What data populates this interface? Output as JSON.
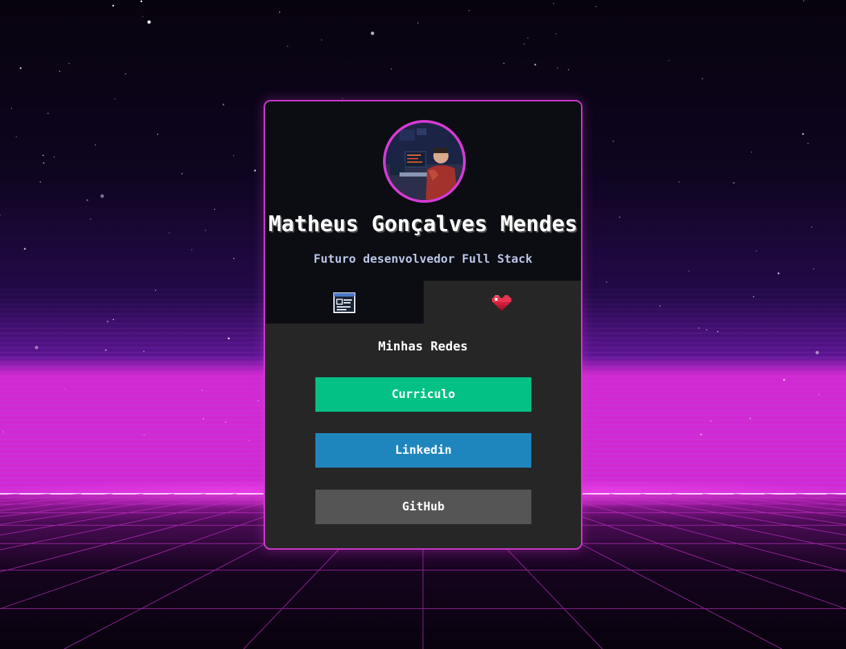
{
  "colors": {
    "accent": "#d53ad3",
    "card_top": "#0b0d12",
    "card_body": "#262626",
    "curriculo": "#03c185",
    "linkedin": "#1f86bd",
    "github": "#555555"
  },
  "profile": {
    "avatar_icon": "profile-photo",
    "name": "Matheus Gonçalves Mendes",
    "subtitle": "Futuro desenvolvedor Full Stack"
  },
  "tabs": [
    {
      "icon": "document-icon",
      "active": false
    },
    {
      "icon": "heart-icon",
      "active": true
    }
  ],
  "links": {
    "title": "Minhas Redes",
    "items": [
      {
        "label": "Curriculo"
      },
      {
        "label": "Linkedin"
      },
      {
        "label": "GitHub"
      }
    ]
  }
}
